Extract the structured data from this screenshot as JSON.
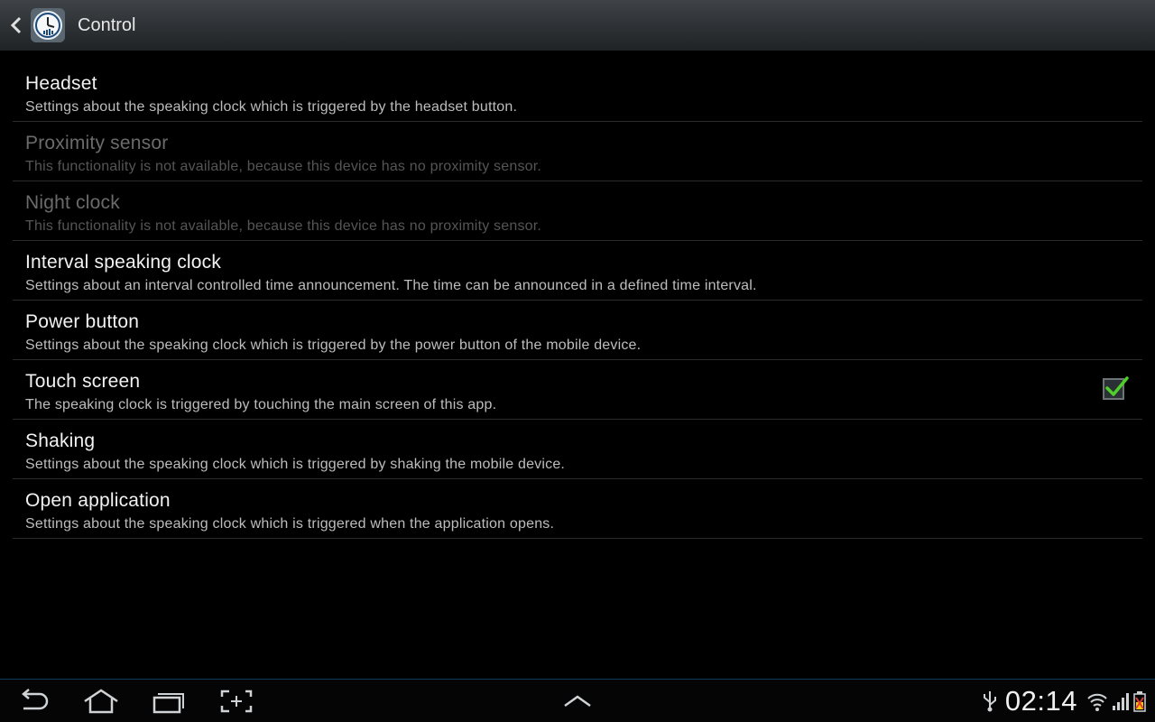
{
  "app_bar": {
    "title": "Control",
    "up_icon": "chevron-left-icon",
    "app_icon": "speaking-clock-icon"
  },
  "preferences": [
    {
      "key": "headset",
      "title": "Headset",
      "summary": "Settings about the speaking clock which is triggered by the headset button.",
      "enabled": true
    },
    {
      "key": "proximity",
      "title": "Proximity sensor",
      "summary": "This functionality is not available, because this device has no proximity sensor.",
      "enabled": false
    },
    {
      "key": "night-clock",
      "title": "Night clock",
      "summary": "This functionality is not available, because this device has no proximity sensor.",
      "enabled": false
    },
    {
      "key": "interval",
      "title": "Interval speaking clock",
      "summary": "Settings about an interval controlled time announcement. The time can be announced in a defined time interval.",
      "enabled": true
    },
    {
      "key": "power-button",
      "title": "Power button",
      "summary": "Settings about the speaking clock which is triggered by the power button of the mobile device.",
      "enabled": true
    },
    {
      "key": "touch-screen",
      "title": "Touch screen",
      "summary": "The speaking clock is triggered by touching the main screen of this app.",
      "enabled": true,
      "checkbox": true,
      "checked": true
    },
    {
      "key": "shaking",
      "title": "Shaking",
      "summary": "Settings about the speaking clock which is triggered by shaking the mobile device.",
      "enabled": true
    },
    {
      "key": "open-application",
      "title": "Open application",
      "summary": "Settings about the speaking clock which is triggered when the application opens.",
      "enabled": true
    }
  ],
  "system_bar": {
    "buttons": [
      "back-icon",
      "home-icon",
      "recent-apps-icon",
      "screenshot-icon",
      "chevron-up-icon"
    ],
    "time": "02:14",
    "status_icons": [
      "usb-icon",
      "wifi-icon",
      "signal-icon",
      "battery-icon"
    ]
  },
  "colors": {
    "background": "#000000",
    "accent": "#33b5e5",
    "check": "#4fcf2a",
    "divider": "#2b2b2b"
  }
}
